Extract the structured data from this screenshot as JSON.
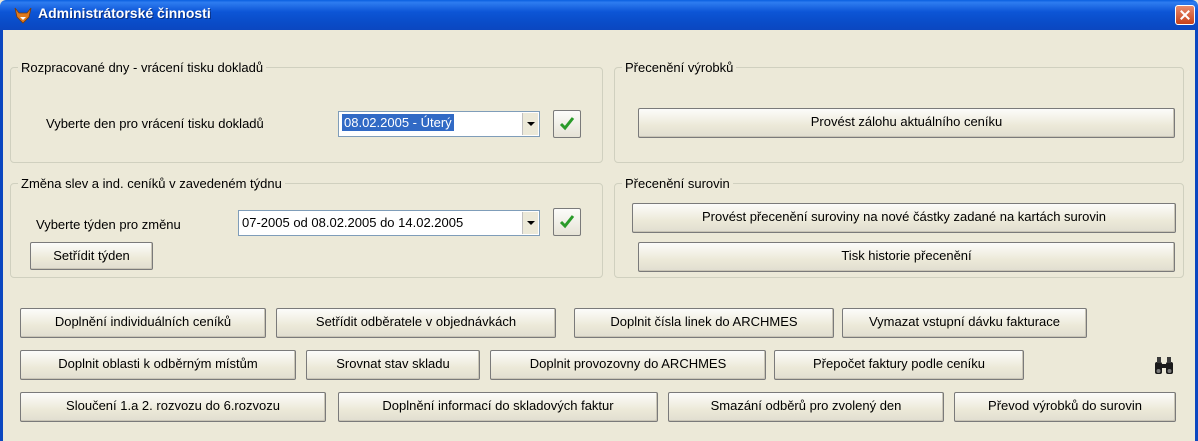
{
  "window": {
    "title": "Administrátorské činnosti"
  },
  "group_days": {
    "legend": "Rozpracované dny - vrácení tisku dokladů",
    "label": "Vyberte den pro vrácení tisku dokladů",
    "selected_day": "08.02.2005 - Úterý"
  },
  "group_revaluation_products": {
    "legend": "Přecenění výrobků",
    "backup_button": "Provést zálohu aktuálního ceníku"
  },
  "group_week": {
    "legend": "Změna slev a ind. ceníků v zavedeném týdnu",
    "label": "Vyberte týden pro změnu",
    "selected_week": "07-2005 od 08.02.2005 do 14.02.2005",
    "sort_button": "Setřídit týden"
  },
  "group_revaluation_materials": {
    "legend": "Přecenění surovin",
    "revalue_button": "Provést přecenění suroviny na nové částky zadané na kartách surovin",
    "history_button": "Tisk historie přecenění"
  },
  "actions": {
    "row1": [
      "Doplnění individuálních ceníků",
      "Setřídit odběratele v objednávkách",
      "Doplnit čísla linek do ARCHMES",
      "Vymazat vstupní dávku fakturace"
    ],
    "row2": [
      "Doplnit oblasti k odběrným místům",
      "Srovnat stav skladu",
      "Doplnit provozovny do ARCHMES",
      "Přepočet faktury podle ceníku"
    ],
    "row3": [
      "Sloučení 1.a 2. rozvozu do 6.rozvozu",
      "Doplnění informací do skladových faktur",
      "Smazání odběrů pro zvolený den",
      "Převod výrobků do surovin"
    ]
  },
  "icons": {
    "confirm": "check-icon",
    "search": "binoculars-icon",
    "app": "fox-icon",
    "close": "close-icon"
  },
  "colors": {
    "titlebar": "#0a4cc8",
    "selection": "#316ac5",
    "check": "#2a9b2a",
    "close": "#c6411b"
  }
}
